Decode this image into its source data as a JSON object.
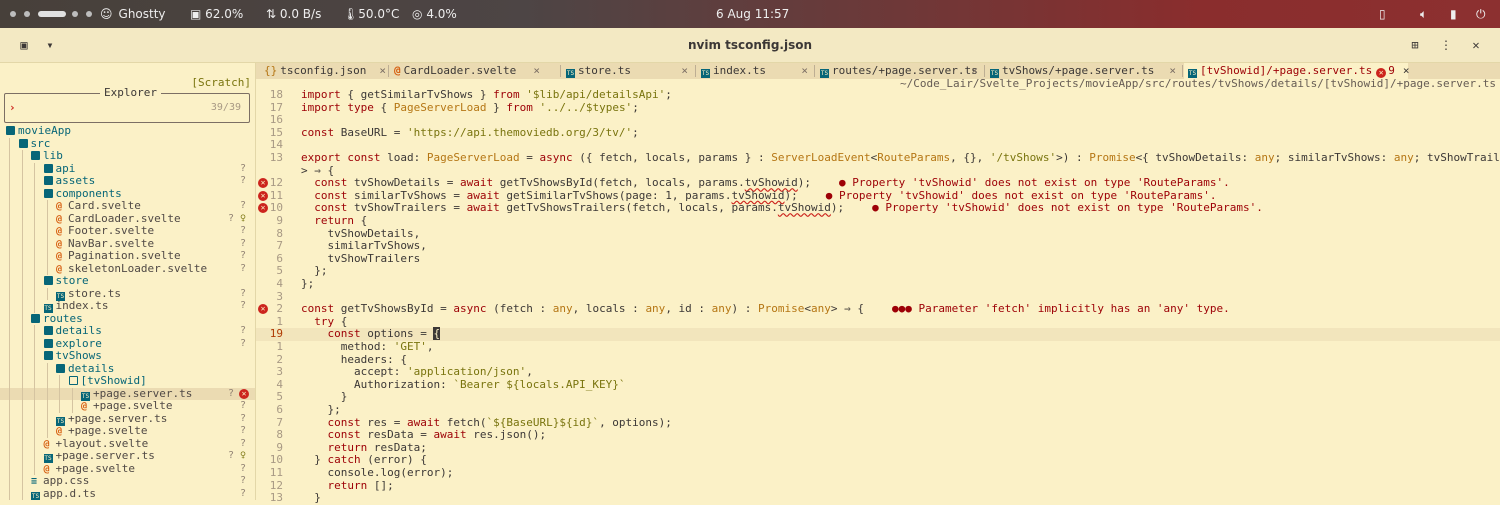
{
  "sysbar": {
    "app": "Ghostty",
    "cpu": "62.0%",
    "net": "0.0 B/s",
    "temp": "50.0°C",
    "misc": "4.0%",
    "clock": "6 Aug  11:57"
  },
  "window": {
    "title": "nvim tsconfig.json"
  },
  "sidebar": {
    "scratch": "[Scratch]",
    "explorer_title": "Explorer",
    "prompt": "›",
    "count": "39/39",
    "tree": [
      {
        "label": "movieApp",
        "kind": "folder",
        "depth": 0,
        "status": ""
      },
      {
        "label": "src",
        "kind": "folder",
        "depth": 1,
        "status": ""
      },
      {
        "label": "lib",
        "kind": "folder",
        "depth": 2,
        "status": ""
      },
      {
        "label": "api",
        "kind": "folder",
        "depth": 3,
        "status": "?"
      },
      {
        "label": "assets",
        "kind": "folder",
        "depth": 3,
        "status": "?"
      },
      {
        "label": "components",
        "kind": "folder",
        "depth": 3,
        "status": ""
      },
      {
        "label": "Card.svelte",
        "kind": "svelte",
        "depth": 4,
        "status": "?"
      },
      {
        "label": "CardLoader.svelte",
        "kind": "svelte",
        "depth": 4,
        "status": "?",
        "extra": "♀"
      },
      {
        "label": "Footer.svelte",
        "kind": "svelte",
        "depth": 4,
        "status": "?"
      },
      {
        "label": "NavBar.svelte",
        "kind": "svelte",
        "depth": 4,
        "status": "?"
      },
      {
        "label": "Pagination.svelte",
        "kind": "svelte",
        "depth": 4,
        "status": "?"
      },
      {
        "label": "skeletonLoader.svelte",
        "kind": "svelte",
        "depth": 4,
        "status": "?"
      },
      {
        "label": "store",
        "kind": "folder",
        "depth": 3,
        "status": ""
      },
      {
        "label": "store.ts",
        "kind": "ts",
        "depth": 4,
        "status": "?"
      },
      {
        "label": "index.ts",
        "kind": "ts",
        "depth": 3,
        "status": "?"
      },
      {
        "label": "routes",
        "kind": "folder",
        "depth": 2,
        "status": ""
      },
      {
        "label": "details",
        "kind": "folder",
        "depth": 3,
        "status": "?"
      },
      {
        "label": "explore",
        "kind": "folder",
        "depth": 3,
        "status": "?"
      },
      {
        "label": "tvShows",
        "kind": "folder",
        "depth": 3,
        "status": ""
      },
      {
        "label": "details",
        "kind": "folder",
        "depth": 4,
        "status": ""
      },
      {
        "label": "[tvShowid]",
        "kind": "openfolder",
        "depth": 5,
        "status": ""
      },
      {
        "label": "+page.server.ts",
        "kind": "ts",
        "depth": 6,
        "status": "?",
        "error": "✕",
        "selected": true
      },
      {
        "label": "+page.svelte",
        "kind": "svelte",
        "depth": 6,
        "status": "?"
      },
      {
        "label": "+page.server.ts",
        "kind": "ts",
        "depth": 4,
        "status": "?"
      },
      {
        "label": "+page.svelte",
        "kind": "svelte",
        "depth": 4,
        "status": "?"
      },
      {
        "label": "+layout.svelte",
        "kind": "svelte",
        "depth": 3,
        "status": "?"
      },
      {
        "label": "+page.server.ts",
        "kind": "ts",
        "depth": 3,
        "status": "?",
        "extra": "♀"
      },
      {
        "label": "+page.svelte",
        "kind": "svelte",
        "depth": 3,
        "status": "?"
      },
      {
        "label": "app.css",
        "kind": "css",
        "depth": 2,
        "status": "?"
      },
      {
        "label": "app.d.ts",
        "kind": "ts",
        "depth": 2,
        "status": "?"
      }
    ]
  },
  "tabs": [
    {
      "icon": "{}",
      "label": "tsconfig.json",
      "close": "×"
    },
    {
      "icon": "@",
      "label": "CardLoader.svelte",
      "close": "×"
    },
    {
      "icon": "ts",
      "label": "store.ts",
      "close": "×"
    },
    {
      "icon": "ts",
      "label": "index.ts",
      "close": "×"
    },
    {
      "icon": "ts",
      "label": "routes/+page.server.ts",
      "close": "×"
    },
    {
      "icon": "ts",
      "label": "tvShows/+page.server.ts",
      "close": "×"
    },
    {
      "icon": "ts",
      "label": "[tvShowid]/+page.server.ts",
      "close": "×",
      "errors": "9",
      "active": true
    }
  ],
  "path": "~/Code_Lair/Svelte_Projects/movieApp/src/routes/tvShows/details/[tvShowid]/+page.server.ts",
  "editor": {
    "lines": [
      {
        "n": "18",
        "code": "import { getSimilarTvShows } from '$lib/api/detailsApi';"
      },
      {
        "n": "17",
        "code": "import type { PageServerLoad } from '../../$types';"
      },
      {
        "n": "16",
        "code": ""
      },
      {
        "n": "15",
        "code": "const BaseURL = 'https://api.themoviedb.org/3/tv/';"
      },
      {
        "n": "14",
        "code": ""
      },
      {
        "n": "13",
        "code": "export const load: PageServerLoad = async ({ fetch, locals, params } : ServerLoadEvent<RouteParams, {}, '/tvShows'>) : Promise<{ tvShowDetails: any; similarTvShows: any; tvShowTrailers: any }"
      },
      {
        "n": "",
        "code": "> ⇒ {"
      },
      {
        "n": "12",
        "err": true,
        "code": "  const tvShowDetails = await getTvShowsById(fetch, locals, params.tvShowid);",
        "diag": "● Property 'tvShowid' does not exist on type 'RouteParams'."
      },
      {
        "n": "11",
        "err": true,
        "code": "  const similarTvShows = await getSimilarTvShows(page: 1, params.tvShowid);",
        "diag": "● Property 'tvShowid' does not exist on type 'RouteParams'."
      },
      {
        "n": "10",
        "err": true,
        "code": "  const tvShowTrailers = await getTvShowsTrailers(fetch, locals, params.tvShowid);",
        "diag": "● Property 'tvShowid' does not exist on type 'RouteParams'."
      },
      {
        "n": "9",
        "code": "  return {"
      },
      {
        "n": "8",
        "code": "    tvShowDetails,"
      },
      {
        "n": "7",
        "code": "    similarTvShows,"
      },
      {
        "n": "6",
        "code": "    tvShowTrailers"
      },
      {
        "n": "5",
        "code": "  };"
      },
      {
        "n": "4",
        "code": "};"
      },
      {
        "n": "3",
        "code": ""
      },
      {
        "n": "2",
        "err": true,
        "code": "const getTvShowsById = async (fetch : any, locals : any, id : any) : Promise<any> ⇒ {",
        "diag": "●●● Parameter 'fetch' implicitly has an 'any' type."
      },
      {
        "n": "1",
        "code": "  try {"
      },
      {
        "n": "19",
        "cur": true,
        "code": "    const options = {"
      },
      {
        "n": "1",
        "code": "      method: 'GET',"
      },
      {
        "n": "2",
        "code": "      headers: {"
      },
      {
        "n": "3",
        "code": "        accept: 'application/json',"
      },
      {
        "n": "4",
        "code": "        Authorization: `Bearer ${locals.API_KEY}`"
      },
      {
        "n": "5",
        "code": "      }"
      },
      {
        "n": "6",
        "code": "    };"
      },
      {
        "n": "7",
        "code": "    const res = await fetch(`${BaseURL}${id}`, options);"
      },
      {
        "n": "8",
        "code": "    const resData = await res.json();"
      },
      {
        "n": "9",
        "code": "    return resData;"
      },
      {
        "n": "10",
        "code": "  } catch (error) {"
      },
      {
        "n": "11",
        "code": "    console.log(error);"
      },
      {
        "n": "12",
        "code": "    return [];"
      },
      {
        "n": "13",
        "code": "  }"
      }
    ]
  },
  "colors": {
    "accent": "#9d0006",
    "bg": "#fbf1c7",
    "folder": "#076678",
    "svelte": "#d65d0e"
  }
}
